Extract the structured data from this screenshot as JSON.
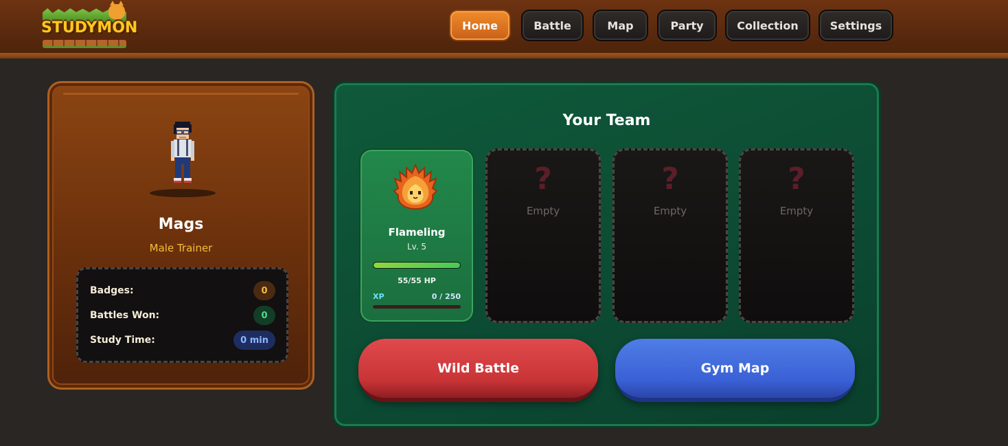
{
  "app": {
    "logo_text": "STUDYMON"
  },
  "nav": {
    "items": [
      {
        "label": "Home",
        "active": true
      },
      {
        "label": "Battle",
        "active": false
      },
      {
        "label": "Map",
        "active": false
      },
      {
        "label": "Party",
        "active": false
      },
      {
        "label": "Collection",
        "active": false
      },
      {
        "label": "Settings",
        "active": false
      }
    ]
  },
  "trainer": {
    "name": "Mags",
    "title": "Male Trainer",
    "sprite_icon": "trainer-sprite-icon",
    "stats": [
      {
        "label": "Badges:",
        "value": "0"
      },
      {
        "label": "Battles Won:",
        "value": "0"
      },
      {
        "label": "Study Time:",
        "value": "0 min"
      }
    ]
  },
  "team": {
    "title": "Your Team",
    "slots": [
      {
        "filled": true,
        "name": "Flameling",
        "level": "Lv. 5",
        "hp_text": "55/55 HP",
        "hp_fraction": 1.0,
        "xp_label": "XP",
        "xp_text": "0 / 250",
        "xp_fraction": 0.0,
        "icon": "flame-creature-icon"
      },
      {
        "filled": false,
        "label": "Empty",
        "icon": "question-mark-icon"
      },
      {
        "filled": false,
        "label": "Empty",
        "icon": "question-mark-icon"
      },
      {
        "filled": false,
        "label": "Empty",
        "icon": "question-mark-icon"
      }
    ],
    "empty_glyph": "?"
  },
  "actions": {
    "wild_battle": "Wild Battle",
    "gym_map": "Gym Map"
  },
  "colors": {
    "accent_orange": "#f08c2a",
    "team_green": "#0f5a3a",
    "wild_red": "#c93436",
    "gym_blue": "#3a61d6",
    "gold": "#f5bf3a"
  }
}
